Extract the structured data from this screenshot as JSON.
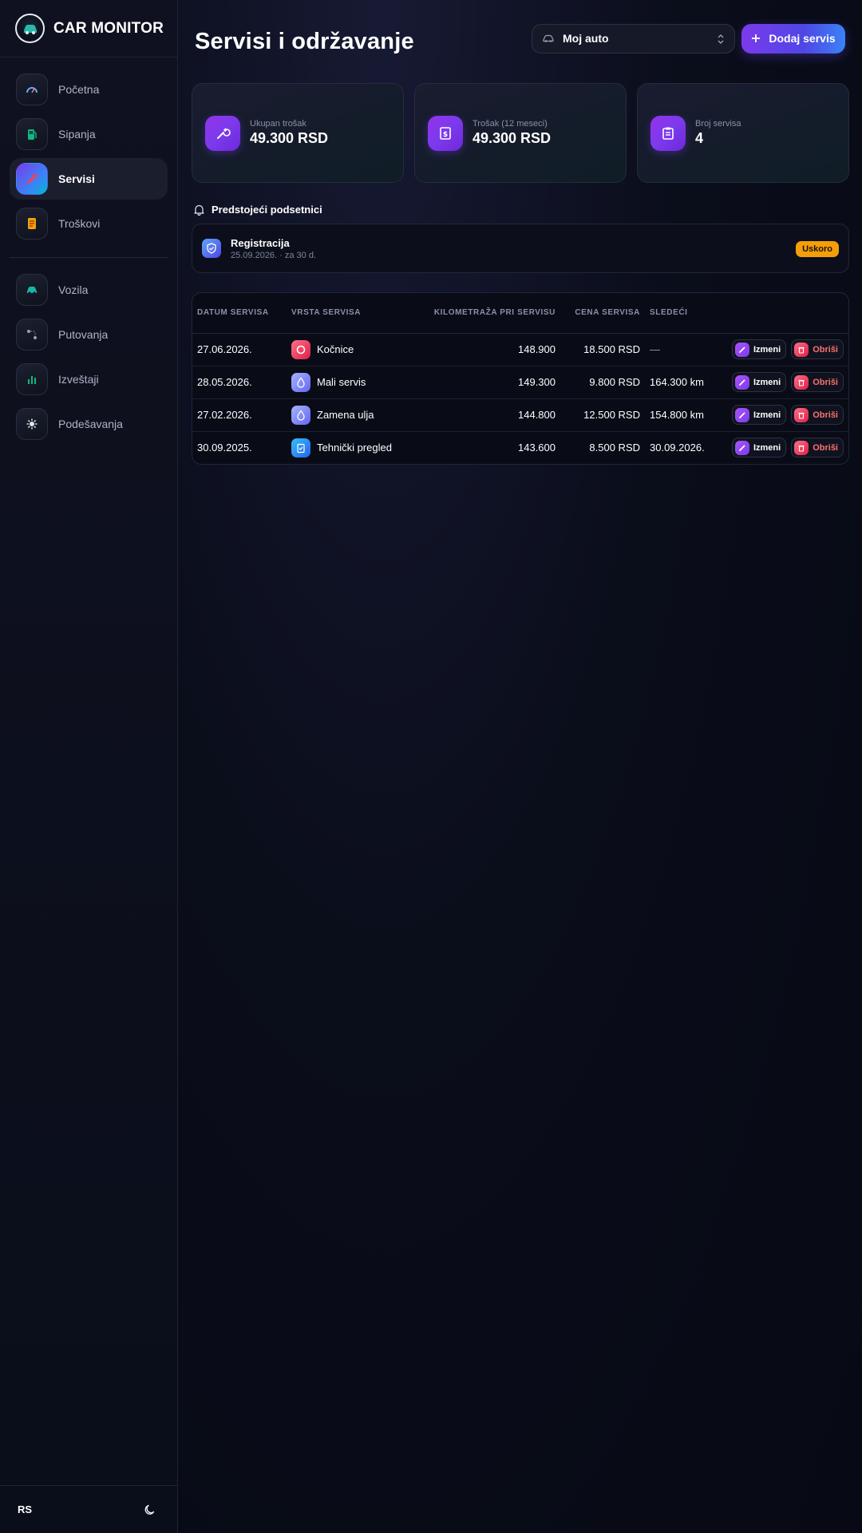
{
  "brand": {
    "name": "CAR MONITOR"
  },
  "sidebar": {
    "items": [
      {
        "label": "Početna",
        "icon": "gauge-icon"
      },
      {
        "label": "Sipanja",
        "icon": "fuel-icon"
      },
      {
        "label": "Servisi",
        "icon": "wrench-icon",
        "active": true
      },
      {
        "label": "Troškovi",
        "icon": "receipt-icon"
      },
      {
        "label": "Vozila",
        "icon": "car-icon"
      },
      {
        "label": "Putovanja",
        "icon": "route-icon"
      },
      {
        "label": "Izveštaji",
        "icon": "chart-icon"
      },
      {
        "label": "Podešavanja",
        "icon": "gear-icon"
      }
    ],
    "language": "RS"
  },
  "header": {
    "title": "Servisi i održavanje",
    "vehicle_select": "Moj auto",
    "add_button": "Dodaj servis"
  },
  "stats": [
    {
      "label": "Ukupan trošak",
      "value": "49.300 RSD",
      "icon": "wrench-icon"
    },
    {
      "label": "Trošak (12 meseci)",
      "value": "49.300 RSD",
      "icon": "receipt-icon"
    },
    {
      "label": "Broj servisa",
      "value": "4",
      "icon": "clipboard-icon"
    }
  ],
  "reminders": {
    "title": "Predstojeći podsetnici",
    "items": [
      {
        "title": "Registracija",
        "subtitle": "25.09.2026. · za 30 d.",
        "badge": "Uskoro"
      }
    ]
  },
  "table": {
    "headers": [
      "DATUM SERVISA",
      "VRSTA SERVISA",
      "KILOMETRAŽA PRI SERVISU",
      "CENA SERVISA",
      "SLEDEĆI"
    ],
    "edit_label": "Izmeni",
    "delete_label": "Obriši",
    "rows": [
      {
        "date": "27.06.2026.",
        "type": "Kočnice",
        "km": "148.900",
        "price": "18.500 RSD",
        "next": "—",
        "icon": "brake-icon",
        "color": "#f43f5e"
      },
      {
        "date": "28.05.2026.",
        "type": "Mali servis",
        "km": "149.300",
        "price": "9.800 RSD",
        "next": "164.300 km",
        "icon": "oil-drop-icon",
        "color": "#818cf8"
      },
      {
        "date": "27.02.2026.",
        "type": "Zamena ulja",
        "km": "144.800",
        "price": "12.500 RSD",
        "next": "154.800 km",
        "icon": "oil-drop-icon",
        "color": "#818cf8"
      },
      {
        "date": "30.09.2025.",
        "type": "Tehnički pregled",
        "km": "143.600",
        "price": "8.500 RSD",
        "next": "30.09.2026.",
        "icon": "clipboard-check-icon",
        "color": "#3b82f6"
      }
    ]
  }
}
